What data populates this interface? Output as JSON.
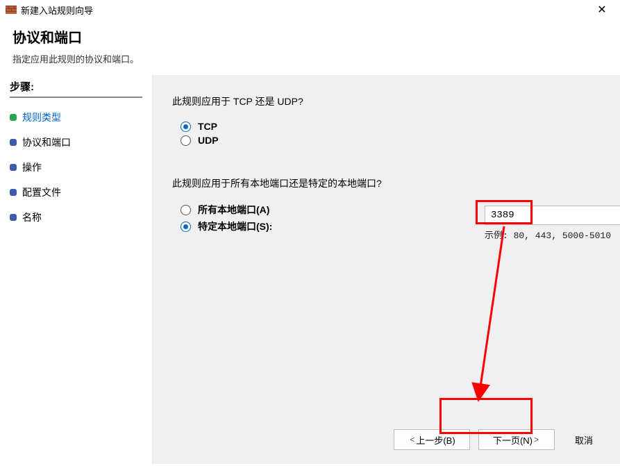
{
  "window": {
    "title": "新建入站规则向导",
    "close": "✕"
  },
  "header": {
    "title": "协议和端口",
    "subtitle": "指定应用此规则的协议和端口。"
  },
  "sidebar": {
    "heading": "步骤:",
    "items": [
      {
        "label": "规则类型"
      },
      {
        "label": "协议和端口"
      },
      {
        "label": "操作"
      },
      {
        "label": "配置文件"
      },
      {
        "label": "名称"
      }
    ]
  },
  "main": {
    "q1": "此规则应用于 TCP 还是 UDP?",
    "opt_tcp": "TCP",
    "opt_udp": "UDP",
    "q2": "此规则应用于所有本地端口还是特定的本地端口?",
    "opt_all": "所有本地端口(A)",
    "opt_specific": "特定本地端口(S):",
    "port_value": "3389",
    "example": "示例: 80, 443, 5000-5010"
  },
  "buttons": {
    "back": "上一步(B)",
    "next": "下一页(N)",
    "cancel": "取消"
  }
}
